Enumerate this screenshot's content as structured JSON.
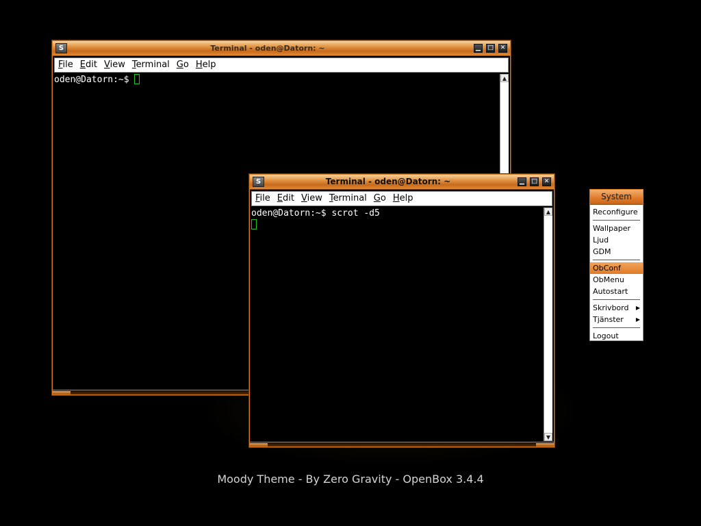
{
  "footer": "Moody Theme  -  By Zero Gravity  -  OpenBox 3.4.4",
  "windows": {
    "back": {
      "title": "Terminal - oden@Datorn: ~",
      "menu": [
        "File",
        "Edit",
        "View",
        "Terminal",
        "Go",
        "Help"
      ],
      "lines": [
        "oden@Datorn:~$ "
      ]
    },
    "front": {
      "title": "Terminal - oden@Datorn: ~",
      "menu": [
        "File",
        "Edit",
        "View",
        "Terminal",
        "Go",
        "Help"
      ],
      "lines": [
        "oden@Datorn:~$ scrot -d5",
        ""
      ]
    }
  },
  "icons": {
    "window": "terminal-window-icon",
    "minimize": "minimize-icon",
    "maximize": "maximize-icon",
    "close": "close-icon",
    "window_glyph": "S",
    "minimize_glyph": "▁",
    "maximize_glyph": "□",
    "close_glyph": "✕",
    "scroll_up_glyph": "▲",
    "scroll_down_glyph": "▼",
    "submenu_glyph": "▶"
  },
  "system_menu": {
    "title": "System",
    "groups": [
      [
        {
          "label": "Reconfigure"
        }
      ],
      [
        {
          "label": "Wallpaper"
        },
        {
          "label": "Ljud"
        },
        {
          "label": "GDM"
        }
      ],
      [
        {
          "label": "ObConf",
          "selected": true
        },
        {
          "label": "ObMenu"
        },
        {
          "label": "Autostart"
        }
      ],
      [
        {
          "label": "Skrivbord",
          "submenu": true
        },
        {
          "label": "Tjänster",
          "submenu": true
        }
      ],
      [
        {
          "label": "Logout"
        }
      ]
    ]
  },
  "colors": {
    "frame": "#d9781c",
    "highlight": "#e07a28",
    "cursor": "#1fc21f",
    "desktop": "#000000"
  }
}
